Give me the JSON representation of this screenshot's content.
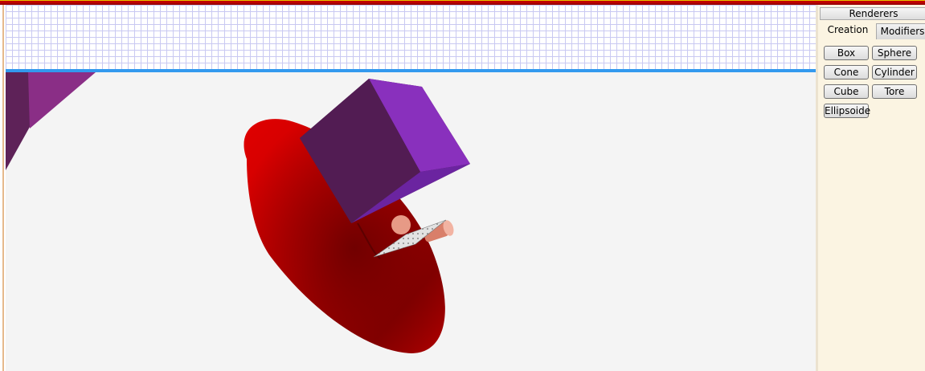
{
  "panel": {
    "header_label": "Renderers",
    "tabs": [
      {
        "label": "Creation",
        "selected": true
      },
      {
        "label": "Modifiers",
        "selected": false
      }
    ],
    "buttons": [
      {
        "label": "Box"
      },
      {
        "label": "Sphere"
      },
      {
        "label": "Cone"
      },
      {
        "label": "Cylinder"
      },
      {
        "label": "Cube"
      },
      {
        "label": "Tore"
      },
      {
        "label": "Ellipsoide"
      }
    ]
  },
  "colors": {
    "grid_line": "#c9c9f2",
    "splitter": "#3399ee",
    "cone": "#cc0000",
    "cube": "#7a2a9a",
    "cylinder": "#e79a86",
    "plane": "#d9d9d9",
    "panel_bg": "#fbf4e2"
  }
}
